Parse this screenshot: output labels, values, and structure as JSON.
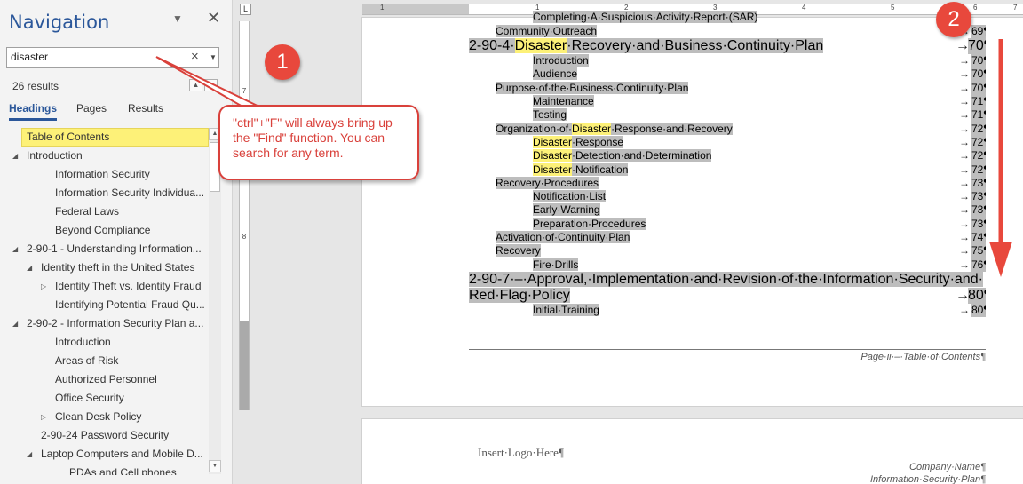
{
  "nav": {
    "title": "Navigation",
    "search_value": "disaster",
    "results": "26 results",
    "tabs": [
      "Headings",
      "Pages",
      "Results"
    ],
    "tree": [
      {
        "label": "Table of Contents",
        "indent": 0,
        "tw": "",
        "selected": true
      },
      {
        "label": "Introduction",
        "indent": 1,
        "tw": "◢"
      },
      {
        "label": "Information Security",
        "indent": 3,
        "tw": ""
      },
      {
        "label": "Information Security Individua...",
        "indent": 3,
        "tw": ""
      },
      {
        "label": "Federal Laws",
        "indent": 3,
        "tw": ""
      },
      {
        "label": "Beyond Compliance",
        "indent": 3,
        "tw": ""
      },
      {
        "label": "2-90-1 - Understanding Information...",
        "indent": 1,
        "tw": "◢"
      },
      {
        "label": "Identity theft in the United States",
        "indent": 2,
        "tw": "◢"
      },
      {
        "label": "Identity Theft vs. Identity Fraud",
        "indent": 3,
        "tw": "▷"
      },
      {
        "label": "Identifying Potential Fraud Qu...",
        "indent": 3,
        "tw": ""
      },
      {
        "label": "2-90-2 - Information Security Plan a...",
        "indent": 1,
        "tw": "◢"
      },
      {
        "label": "Introduction",
        "indent": 3,
        "tw": ""
      },
      {
        "label": "Areas of Risk",
        "indent": 3,
        "tw": ""
      },
      {
        "label": "Authorized Personnel",
        "indent": 3,
        "tw": ""
      },
      {
        "label": "Office Security",
        "indent": 3,
        "tw": ""
      },
      {
        "label": "Clean Desk Policy",
        "indent": 3,
        "tw": "▷"
      },
      {
        "label": "2-90-24 Password Security",
        "indent": 2,
        "tw": ""
      },
      {
        "label": "Laptop Computers and Mobile D...",
        "indent": 2,
        "tw": "◢"
      },
      {
        "label": "PDAs and Cell phones",
        "indent": 4,
        "tw": ""
      }
    ]
  },
  "rulers": {
    "h_numbers": [
      "1",
      "1",
      "2",
      "3",
      "4",
      "5",
      "6",
      "7"
    ],
    "v_numbers": [
      "7",
      "8"
    ]
  },
  "toc": [
    {
      "segs": [
        {
          "t": "Completing·A·Suspicious·Activity·Report·(SAR)"
        }
      ],
      "page": "",
      "level": 2,
      "cut": true
    },
    {
      "segs": [
        {
          "t": "Community·Outreach"
        }
      ],
      "page": "69¶",
      "level": 1
    },
    {
      "segs": [
        {
          "t": "2-90-4·"
        },
        {
          "t": "Disaster",
          "hl": true
        },
        {
          "t": "·Recovery·and·Business·Continuity·Plan"
        }
      ],
      "page": "70¶",
      "level": 0
    },
    {
      "segs": [
        {
          "t": "Introduction"
        }
      ],
      "page": "70¶",
      "level": 2
    },
    {
      "segs": [
        {
          "t": "Audience"
        }
      ],
      "page": "70¶",
      "level": 2
    },
    {
      "segs": [
        {
          "t": "Purpose·of·the·Business·Continuity·Plan"
        }
      ],
      "page": "70¶",
      "level": 1
    },
    {
      "segs": [
        {
          "t": "Maintenance"
        }
      ],
      "page": "71¶",
      "level": 2
    },
    {
      "segs": [
        {
          "t": "Testing"
        }
      ],
      "page": "71¶",
      "level": 2
    },
    {
      "segs": [
        {
          "t": "Organization·of·"
        },
        {
          "t": "Disaster",
          "hl": true
        },
        {
          "t": "·Response·and·Recovery"
        }
      ],
      "page": "72¶",
      "level": 1
    },
    {
      "segs": [
        {
          "t": "Disaster",
          "hl": true
        },
        {
          "t": "·Response"
        }
      ],
      "page": "72¶",
      "level": 2
    },
    {
      "segs": [
        {
          "t": "Disaster",
          "hl": true
        },
        {
          "t": "·Detection·and·Determination"
        }
      ],
      "page": "72¶",
      "level": 2
    },
    {
      "segs": [
        {
          "t": "Disaster",
          "hl": true
        },
        {
          "t": "·Notification"
        }
      ],
      "page": "72¶",
      "level": 2
    },
    {
      "segs": [
        {
          "t": "Recovery·Procedures"
        }
      ],
      "page": "73¶",
      "level": 1
    },
    {
      "segs": [
        {
          "t": "Notification·List"
        }
      ],
      "page": "73¶",
      "level": 2
    },
    {
      "segs": [
        {
          "t": "Early·Warning"
        }
      ],
      "page": "73¶",
      "level": 2
    },
    {
      "segs": [
        {
          "t": "Preparation·Procedures"
        }
      ],
      "page": "73¶",
      "level": 2
    },
    {
      "segs": [
        {
          "t": "Activation·of·Continuity·Plan"
        }
      ],
      "page": "74¶",
      "level": 1
    },
    {
      "segs": [
        {
          "t": "Recovery"
        }
      ],
      "page": "75¶",
      "level": 1
    },
    {
      "segs": [
        {
          "t": "Fire·Drills"
        }
      ],
      "page": "76¶",
      "level": 2
    },
    {
      "segs": [
        {
          "t": "2-90-7·–·Approval,·Implementation·and·Revision·of·the·Information·Security·and·"
        }
      ],
      "page": "",
      "level": 0,
      "wrap": true
    },
    {
      "segs": [
        {
          "t": "Red·Flag·Policy"
        }
      ],
      "page": "80¶",
      "level": 0
    },
    {
      "segs": [
        {
          "t": "Initial·Training"
        }
      ],
      "page": "80¶",
      "level": 2
    }
  ],
  "page1_footer": "Page·ii·–·Table·of·Contents¶",
  "page2": {
    "logo": "Insert·Logo·Here¶",
    "company_name": "Company·Name¶",
    "plan_name": "Information·Security·Plan¶"
  },
  "annotations": {
    "badge1": "1",
    "badge2": "2",
    "callout": "\"ctrl\"+\"F\" will always bring up the \"Find\" function. You can search for any term."
  },
  "colors": {
    "accent": "#2b579a",
    "highlight": "#fdf178",
    "annotation_red": "#e8483c"
  },
  "icons": {
    "close": "close-icon",
    "clear": "clear-search-icon",
    "dropdown": "chevron-down-icon",
    "prev": "previous-result-icon",
    "next": "next-result-icon"
  }
}
